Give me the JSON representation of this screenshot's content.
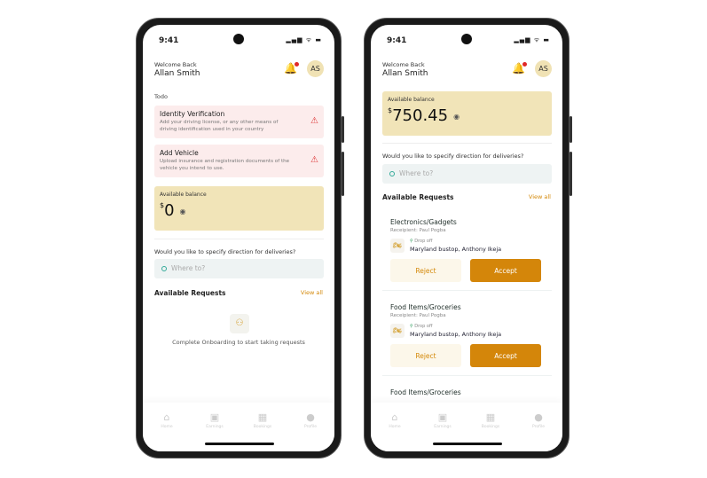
{
  "status": {
    "time": "9:41",
    "signal": "▂▄▆ ᯤ ▬"
  },
  "header": {
    "welcome": "Welcome Back",
    "name": "Allan Smith",
    "avatar": "AS"
  },
  "screen1": {
    "todo_label": "Todo",
    "todos": [
      {
        "title": "Identity Verification",
        "desc": "Add your driving license, or any other means of  driving identification used in your country"
      },
      {
        "title": "Add Vehicle",
        "desc": "Upload insurance and registration documents of the vehicle you intend to use."
      }
    ],
    "balance": {
      "label": "Available balance",
      "currency": "$",
      "amount": "0"
    },
    "empty": "Complete Onboarding to start taking requests"
  },
  "screen2": {
    "balance": {
      "label": "Available balance",
      "currency": "$",
      "amount": "750.45"
    },
    "requests": [
      {
        "title": "Electronics/Gadgets",
        "recipient": "Receipient: Paul Pogba",
        "drop_label": "Drop off",
        "address": "Maryland bustop, Anthony Ikeja"
      },
      {
        "title": "Food Items/Groceries",
        "recipient": "Receipient: Paul Pogba",
        "drop_label": "Drop off",
        "address": "Maryland bustop, Anthony Ikeja"
      },
      {
        "title": "Food Items/Groceries"
      }
    ],
    "reject": "Reject",
    "accept": "Accept"
  },
  "direction": {
    "question": "Would you like to specify direction for deliveries?",
    "placeholder": "Where to?"
  },
  "requests_header": {
    "title": "Available Requests",
    "view_all": "View all"
  },
  "nav": [
    {
      "label": "Home",
      "icon": "home-icon"
    },
    {
      "label": "Earnings",
      "icon": "wallet-icon"
    },
    {
      "label": "Bookings",
      "icon": "calendar-icon"
    },
    {
      "label": "Profile",
      "icon": "user-icon"
    }
  ],
  "colors": {
    "accent": "#d4860a",
    "balance_bg": "#f1e4b8",
    "todo_bg": "#fcecec"
  }
}
